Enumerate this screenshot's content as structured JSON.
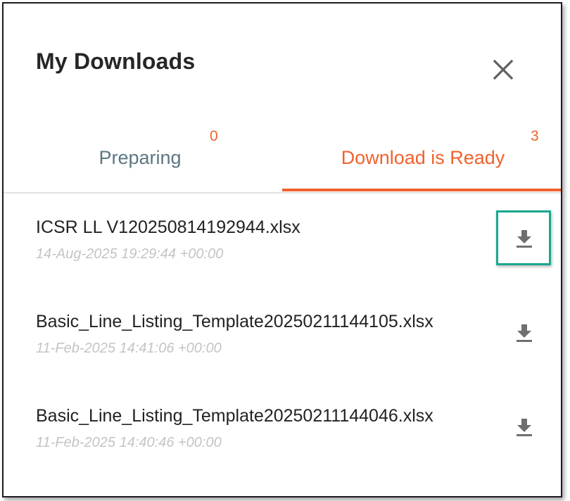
{
  "dialog": {
    "title": "My Downloads",
    "close_icon": "close-icon"
  },
  "tabs": [
    {
      "label": "Preparing",
      "count": "0",
      "active": false
    },
    {
      "label": "Download is Ready",
      "count": "3",
      "active": true
    }
  ],
  "colors": {
    "accent": "#f0622d",
    "inactive_tab": "#5b7782",
    "highlight": "#1aa88f",
    "timestamp": "#c4c4c4"
  },
  "downloads": [
    {
      "name": "ICSR LL V120250814192944.xlsx",
      "timestamp": "14-Aug-2025 19:29:44 +00:00",
      "icon": "download-icon",
      "highlighted": true
    },
    {
      "name": "Basic_Line_Listing_Template20250211144105.xlsx",
      "timestamp": "11-Feb-2025 14:41:06 +00:00",
      "icon": "download-icon",
      "highlighted": false
    },
    {
      "name": "Basic_Line_Listing_Template20250211144046.xlsx",
      "timestamp": "11-Feb-2025 14:40:46 +00:00",
      "icon": "download-icon",
      "highlighted": false
    }
  ]
}
